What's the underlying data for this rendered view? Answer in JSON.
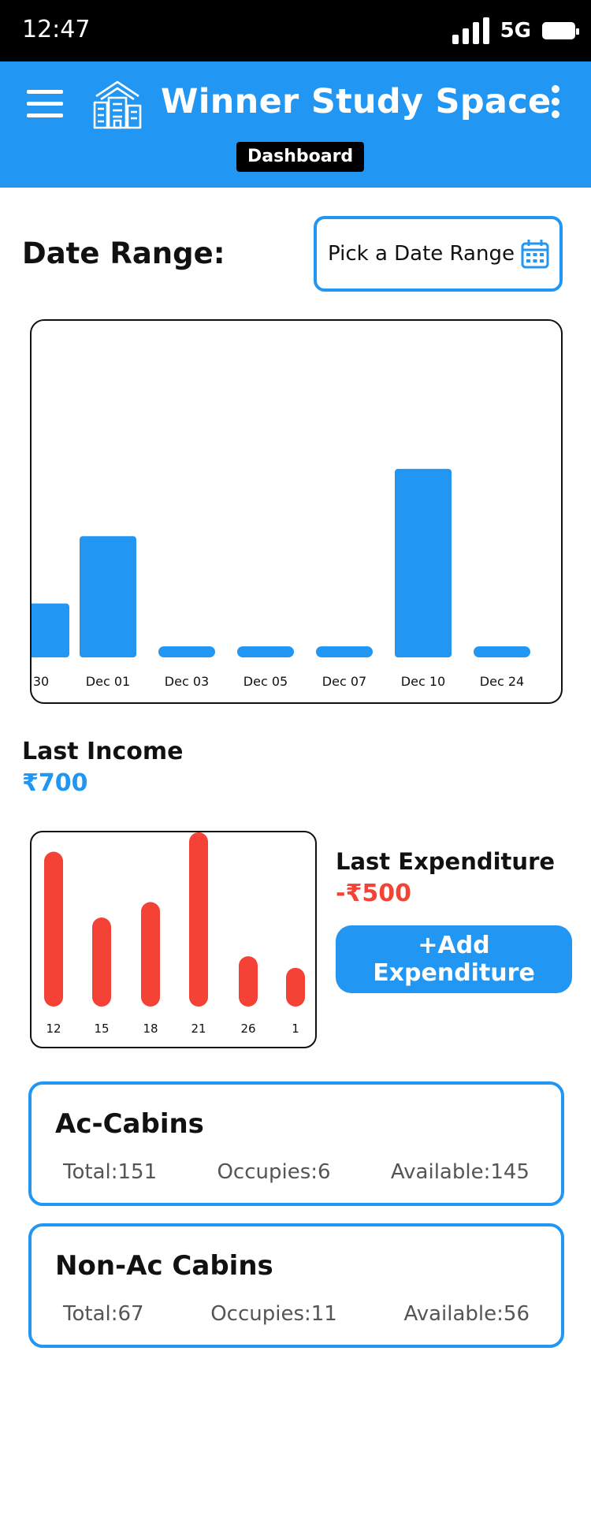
{
  "status_bar": {
    "time": "12:47",
    "network": "5G"
  },
  "app_bar": {
    "title": "Winner Study Space",
    "page_chip": "Dashboard",
    "brand_color": "#2196f3"
  },
  "date_range": {
    "label": "Date Range:",
    "picker_text": "Pick a Date Range"
  },
  "income_chart": {
    "bar_color": "#2196f3"
  },
  "chart_data": [
    {
      "type": "bar",
      "categories": [
        "30",
        "Dec 01",
        "Dec 03",
        "Dec 05",
        "Dec 07",
        "Dec 10",
        "Dec 24"
      ],
      "values": [
        200,
        450,
        0,
        0,
        0,
        700,
        0
      ],
      "title": "",
      "xlabel": "",
      "ylabel": "",
      "ylim": [
        0,
        1200
      ]
    },
    {
      "type": "bar",
      "categories": [
        "12",
        "15",
        "18",
        "21",
        "26",
        "1"
      ],
      "values": [
        400,
        230,
        270,
        450,
        130,
        100
      ],
      "title": "",
      "xlabel": "",
      "ylabel": "",
      "ylim": [
        0,
        450
      ]
    }
  ],
  "last_income": {
    "label": "Last Income",
    "value": "₹700"
  },
  "last_expenditure": {
    "label": "Last Expenditure",
    "value": "-₹500",
    "bar_color": "#f44336"
  },
  "add_expenditure_button": "+Add Expenditure",
  "cabins": [
    {
      "title": "Ac-Cabins",
      "total": "Total:151",
      "occupied": "Occupies:6",
      "available": "Available:145"
    },
    {
      "title": "Non-Ac Cabins",
      "total": "Total:67",
      "occupied": "Occupies:11",
      "available": "Available:56"
    }
  ]
}
